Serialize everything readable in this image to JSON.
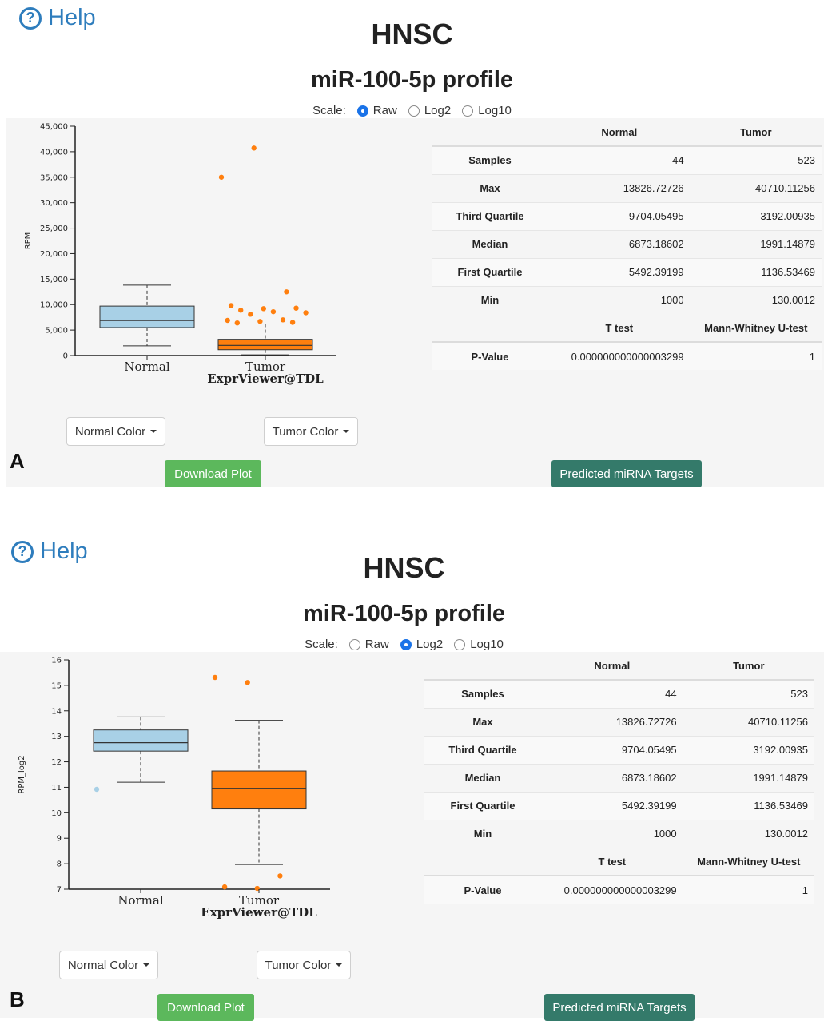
{
  "colors": {
    "normal": "#a8d0e6",
    "tumor": "#ff7f0e",
    "help": "#2e7dbd",
    "green": "#5cb85c",
    "teal": "#347a6a"
  },
  "panels": [
    {
      "letter": "A",
      "help": "Help",
      "cancer": "HNSC",
      "profile": "miR-100-5p profile",
      "scale": {
        "label": "Scale:",
        "options": [
          "Raw",
          "Log2",
          "Log10"
        ],
        "selected": "Raw"
      },
      "buttons": {
        "normal_color": "Normal Color",
        "tumor_color": "Tumor Color",
        "download": "Download Plot",
        "targets": "Predicted miRNA Targets"
      },
      "stats": {
        "headers": [
          "",
          "Normal",
          "Tumor"
        ],
        "rows": [
          {
            "label": "Samples",
            "normal": "44",
            "tumor": "523"
          },
          {
            "label": "Max",
            "normal": "13826.72726",
            "tumor": "40710.11256"
          },
          {
            "label": "Third Quartile",
            "normal": "9704.05495",
            "tumor": "3192.00935"
          },
          {
            "label": "Median",
            "normal": "6873.18602",
            "tumor": "1991.14879"
          },
          {
            "label": "First Quartile",
            "normal": "5492.39199",
            "tumor": "1136.53469"
          },
          {
            "label": "Min",
            "normal": "1000",
            "tumor": "130.0012"
          }
        ],
        "test_headers": [
          "",
          "T test",
          "Mann-Whitney U-test"
        ],
        "test_row": {
          "label": "P-Value",
          "ttest": "0.000000000000003299",
          "mw": "1"
        }
      },
      "chart_data": {
        "type": "box",
        "ylabel": "RPM",
        "ylim": [
          0,
          45000
        ],
        "yticks": [
          0,
          5000,
          10000,
          15000,
          20000,
          25000,
          30000,
          35000,
          40000,
          45000
        ],
        "ytick_labels": [
          "0",
          "5,000",
          "10,000",
          "15,000",
          "20,000",
          "25,000",
          "30,000",
          "35,000",
          "40,000",
          "45,000"
        ],
        "categories": [
          "Normal",
          "Tumor"
        ],
        "watermark": "ExprViewer@TDL",
        "boxes": [
          {
            "name": "Normal",
            "lower_whisker": 1900,
            "q1": 5492,
            "median": 6873,
            "q3": 9704,
            "upper_whisker": 13827,
            "outliers": []
          },
          {
            "name": "Tumor",
            "lower_whisker": 130,
            "q1": 1137,
            "median": 1991,
            "q3": 3192,
            "upper_whisker": 6200,
            "outliers": [
              35000,
              40710,
              12500,
              9800,
              9200,
              9300,
              8900,
              8600,
              8400,
              8100,
              7000,
              6900,
              6700,
              6500,
              6400
            ]
          }
        ]
      }
    },
    {
      "letter": "B",
      "help": "Help",
      "cancer": "HNSC",
      "profile": "miR-100-5p profile",
      "scale": {
        "label": "Scale:",
        "options": [
          "Raw",
          "Log2",
          "Log10"
        ],
        "selected": "Log2"
      },
      "buttons": {
        "normal_color": "Normal Color",
        "tumor_color": "Tumor Color",
        "download": "Download Plot",
        "targets": "Predicted miRNA Targets"
      },
      "stats": {
        "headers": [
          "",
          "Normal",
          "Tumor"
        ],
        "rows": [
          {
            "label": "Samples",
            "normal": "44",
            "tumor": "523"
          },
          {
            "label": "Max",
            "normal": "13826.72726",
            "tumor": "40710.11256"
          },
          {
            "label": "Third Quartile",
            "normal": "9704.05495",
            "tumor": "3192.00935"
          },
          {
            "label": "Median",
            "normal": "6873.18602",
            "tumor": "1991.14879"
          },
          {
            "label": "First Quartile",
            "normal": "5492.39199",
            "tumor": "1136.53469"
          },
          {
            "label": "Min",
            "normal": "1000",
            "tumor": "130.0012"
          }
        ],
        "test_headers": [
          "",
          "T test",
          "Mann-Whitney U-test"
        ],
        "test_row": {
          "label": "P-Value",
          "ttest": "0.000000000000003299",
          "mw": "1"
        }
      },
      "chart_data": {
        "type": "box",
        "ylabel": "RPM_log2",
        "ylim": [
          7,
          16
        ],
        "yticks": [
          7,
          8,
          9,
          10,
          11,
          12,
          13,
          14,
          15,
          16
        ],
        "ytick_labels": [
          "7",
          "8",
          "9",
          "10",
          "11",
          "12",
          "13",
          "14",
          "15",
          "16"
        ],
        "categories": [
          "Normal",
          "Tumor"
        ],
        "watermark": "ExprViewer@TDL",
        "boxes": [
          {
            "name": "Normal",
            "lower_whisker": 11.2,
            "q1": 12.42,
            "median": 12.75,
            "q3": 13.25,
            "upper_whisker": 13.76,
            "outliers": [
              10.92
            ]
          },
          {
            "name": "Tumor",
            "lower_whisker": 7.97,
            "q1": 10.15,
            "median": 10.96,
            "q3": 11.64,
            "upper_whisker": 13.63,
            "outliers": [
              15.31,
              15.11,
              7.52,
              7.09,
              7.03
            ]
          }
        ]
      }
    }
  ]
}
